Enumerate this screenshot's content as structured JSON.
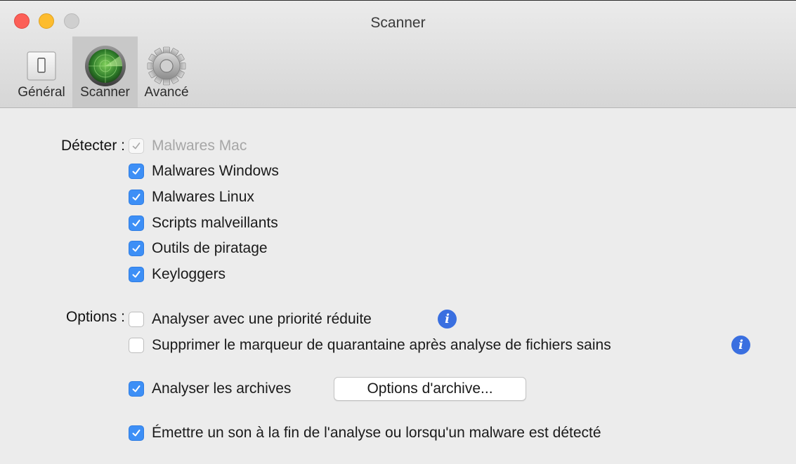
{
  "window": {
    "title": "Scanner"
  },
  "toolbar": {
    "tabs": [
      {
        "label": "Général",
        "icon": "switch-icon"
      },
      {
        "label": "Scanner",
        "icon": "radar-icon",
        "selected": true
      },
      {
        "label": "Avancé",
        "icon": "gear-icon"
      }
    ]
  },
  "detect": {
    "label": "Détecter :",
    "items": [
      {
        "label": "Malwares Mac",
        "checked": true,
        "disabled": true
      },
      {
        "label": "Malwares Windows",
        "checked": true
      },
      {
        "label": "Malwares Linux",
        "checked": true
      },
      {
        "label": "Scripts malveillants",
        "checked": true
      },
      {
        "label": "Outils de piratage",
        "checked": true
      },
      {
        "label": "Keyloggers",
        "checked": true
      }
    ]
  },
  "options": {
    "label": "Options :",
    "items": [
      {
        "label": "Analyser avec une priorité réduite",
        "checked": false,
        "info": "i"
      },
      {
        "label": "Supprimer le marqueur de quarantaine après analyse de fichiers sains",
        "checked": false,
        "info": "i"
      },
      {
        "label": "Analyser les archives",
        "checked": true
      },
      {
        "label": "Émettre un son à la fin de l'analyse ou lorsqu'un malware est détecté",
        "checked": true
      }
    ],
    "archive_button": "Options d'archive..."
  },
  "colors": {
    "accent": "#3d8ff6",
    "info": "#3a6fe0"
  }
}
